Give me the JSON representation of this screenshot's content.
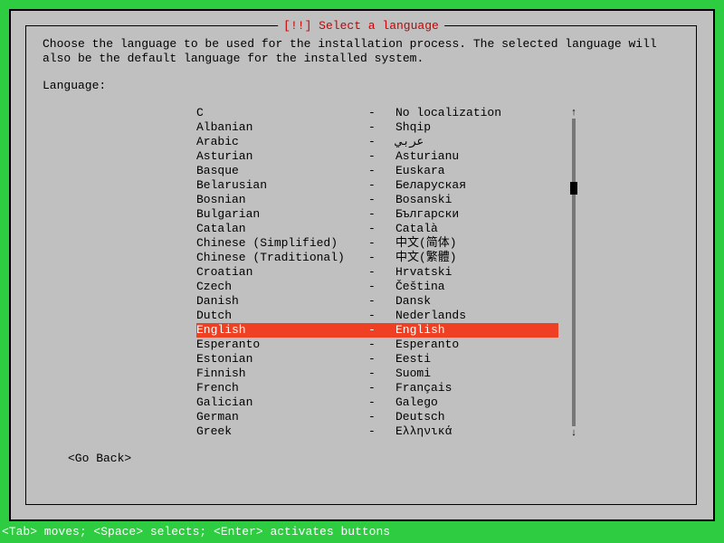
{
  "dialog": {
    "title": "[!!] Select a language",
    "instruction": "Choose the language to be used for the installation process. The selected language will also be the default language for the installed system.",
    "label": "Language:",
    "go_back": "<Go Back>"
  },
  "languages": [
    {
      "name": "C",
      "native": "No localization",
      "selected": false
    },
    {
      "name": "Albanian",
      "native": "Shqip",
      "selected": false
    },
    {
      "name": "Arabic",
      "native": "عربي",
      "selected": false
    },
    {
      "name": "Asturian",
      "native": "Asturianu",
      "selected": false
    },
    {
      "name": "Basque",
      "native": "Euskara",
      "selected": false
    },
    {
      "name": "Belarusian",
      "native": "Беларуская",
      "selected": false
    },
    {
      "name": "Bosnian",
      "native": "Bosanski",
      "selected": false
    },
    {
      "name": "Bulgarian",
      "native": "Български",
      "selected": false
    },
    {
      "name": "Catalan",
      "native": "Català",
      "selected": false
    },
    {
      "name": "Chinese (Simplified)",
      "native": "中文(简体)",
      "selected": false
    },
    {
      "name": "Chinese (Traditional)",
      "native": "中文(繁體)",
      "selected": false
    },
    {
      "name": "Croatian",
      "native": "Hrvatski",
      "selected": false
    },
    {
      "name": "Czech",
      "native": "Čeština",
      "selected": false
    },
    {
      "name": "Danish",
      "native": "Dansk",
      "selected": false
    },
    {
      "name": "Dutch",
      "native": "Nederlands",
      "selected": false
    },
    {
      "name": "English",
      "native": "English",
      "selected": true
    },
    {
      "name": "Esperanto",
      "native": "Esperanto",
      "selected": false
    },
    {
      "name": "Estonian",
      "native": "Eesti",
      "selected": false
    },
    {
      "name": "Finnish",
      "native": "Suomi",
      "selected": false
    },
    {
      "name": "French",
      "native": "Français",
      "selected": false
    },
    {
      "name": "Galician",
      "native": "Galego",
      "selected": false
    },
    {
      "name": "German",
      "native": "Deutsch",
      "selected": false
    },
    {
      "name": "Greek",
      "native": "Ελληνικά",
      "selected": false
    }
  ],
  "separator": "-",
  "scroll": {
    "up": "↑",
    "down": "↓"
  },
  "footer": "<Tab> moves; <Space> selects; <Enter> activates buttons"
}
